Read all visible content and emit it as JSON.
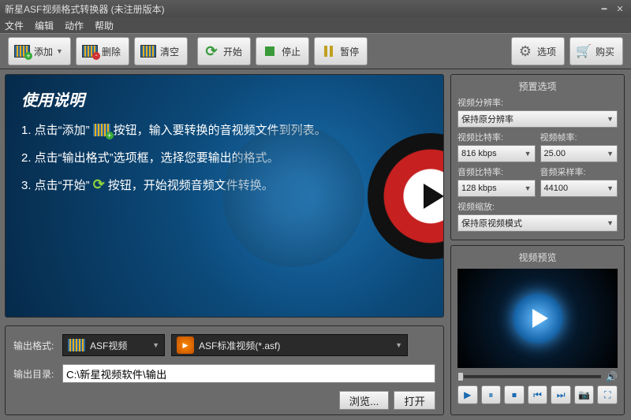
{
  "title": "新星ASF视频格式转换器   (未注册版本)",
  "menu": [
    "文件",
    "编辑",
    "动作",
    "帮助"
  ],
  "toolbar": {
    "add": "添加",
    "delete": "删除",
    "clear": "清空",
    "start": "开始",
    "stop": "停止",
    "pause": "暂停",
    "options": "选项",
    "buy": "购买"
  },
  "banner": {
    "heading": "使用说明",
    "step1a": "1. 点击“添加”",
    "step1b": "按钮，输入要转换的音视频文件到列表。",
    "step2": "2. 点击“输出格式”选项框，选择您要输出的格式。",
    "step3a": "3. 点击“开始”",
    "step3b": "按钮，开始视频音频文件转换。"
  },
  "output": {
    "format_label": "输出格式:",
    "format_group": "ASF视频",
    "format_preset": "ASF标准视频(*.asf)",
    "dir_label": "输出目录:",
    "dir_path": "C:\\新星视频软件\\输出",
    "browse": "浏览...",
    "open": "打开"
  },
  "preset_panel": {
    "title": "预置选项",
    "resolution_label": "视频分辨率:",
    "resolution_value": "保持原分辨率",
    "vbitrate_label": "视频比特率:",
    "vbitrate_value": "816 kbps",
    "fps_label": "视频帧率:",
    "fps_value": "25.00",
    "abitrate_label": "音频比特率:",
    "abitrate_value": "128 kbps",
    "asample_label": "音频采样率:",
    "asample_value": "44100",
    "scale_label": "视频缩放:",
    "scale_value": "保持原视频模式"
  },
  "preview_title": "视频预览"
}
